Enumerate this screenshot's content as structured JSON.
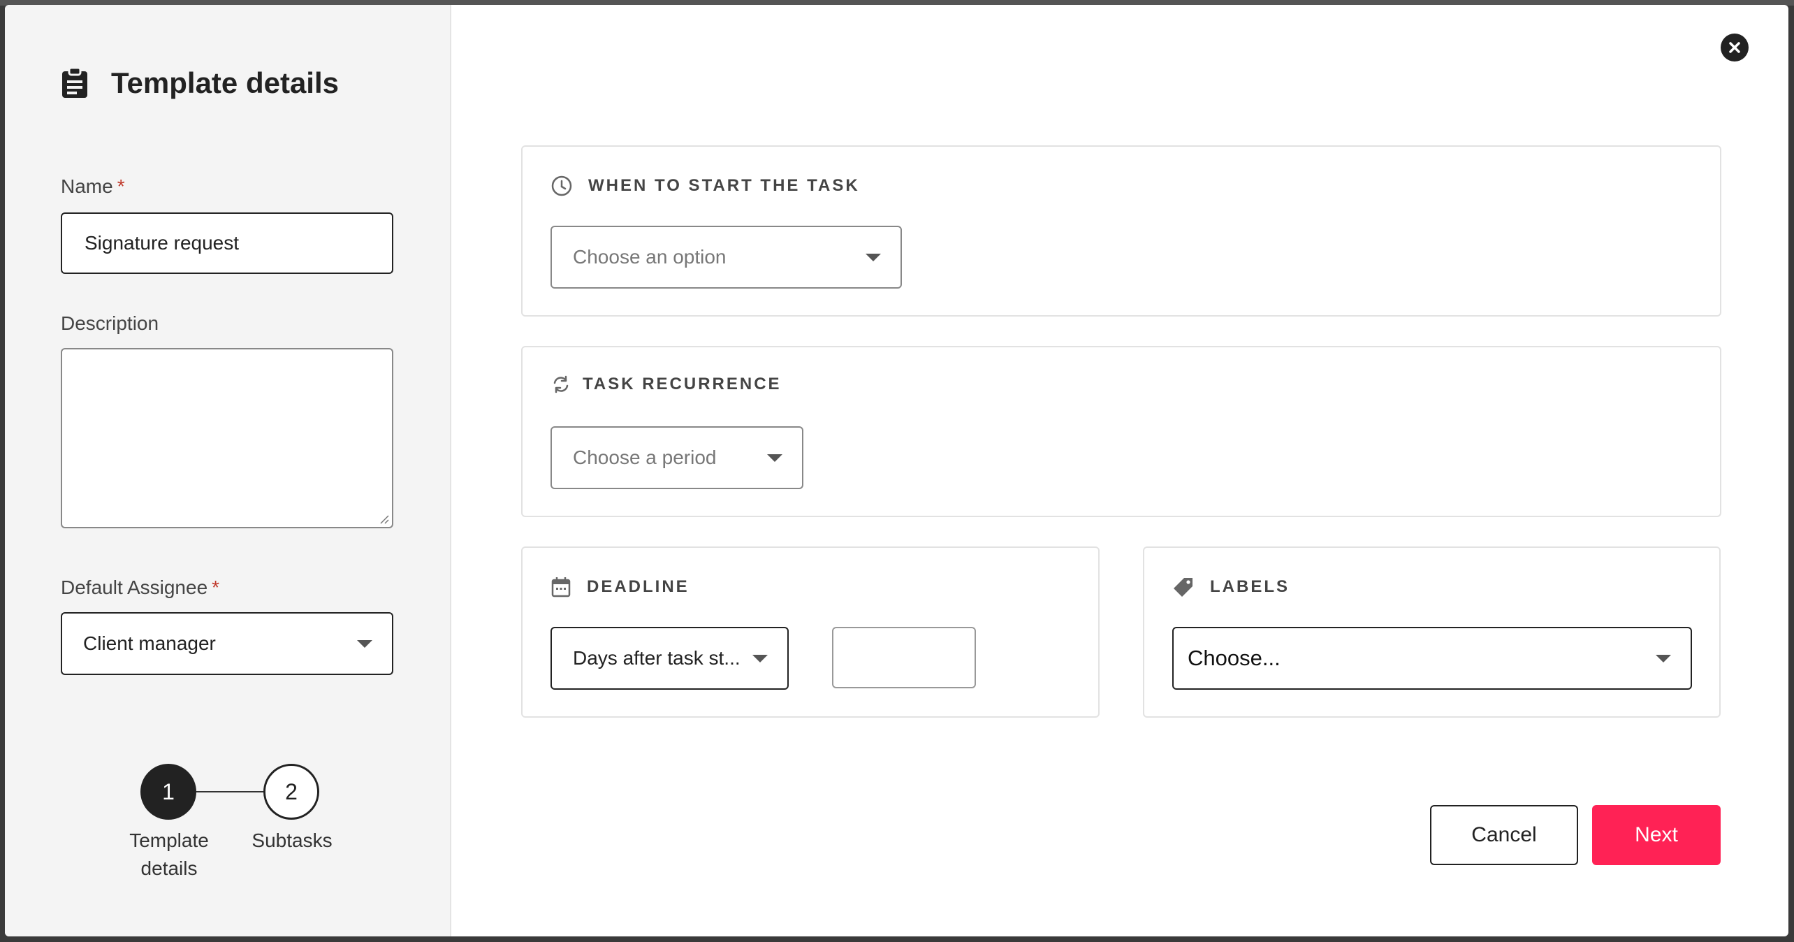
{
  "modal": {
    "title": "Template details",
    "title_icon": "clipboard-icon",
    "close_icon": "close-icon"
  },
  "form": {
    "name": {
      "label": "Name",
      "required_mark": "*",
      "value": "Signature request"
    },
    "description": {
      "label": "Description",
      "value": ""
    },
    "default_assignee": {
      "label": "Default Assignee",
      "required_mark": "*",
      "value": "Client manager"
    }
  },
  "stepper": {
    "steps": [
      {
        "number": "1",
        "label_line1": "Template",
        "label_line2": "details",
        "active": true
      },
      {
        "number": "2",
        "label_line1": "Subtasks",
        "label_line2": "",
        "active": false
      }
    ]
  },
  "sections": {
    "start": {
      "heading": "WHEN TO START THE TASK",
      "icon": "clock-icon",
      "placeholder": "Choose an option"
    },
    "recurrence": {
      "heading": "TASK RECURRENCE",
      "icon": "refresh-icon",
      "placeholder": "Choose a period"
    },
    "deadline": {
      "heading": "DEADLINE",
      "icon": "calendar-icon",
      "mode_value": "Days after task st...",
      "days_value": ""
    },
    "labels": {
      "heading": "LABELS",
      "icon": "tag-icon",
      "placeholder": "Choose..."
    }
  },
  "actions": {
    "cancel_label": "Cancel",
    "next_label": "Next"
  },
  "colors": {
    "accent": "#ff2255",
    "left_panel_bg": "#f4f4f4",
    "required": "#c0392b",
    "dark": "#222222"
  }
}
